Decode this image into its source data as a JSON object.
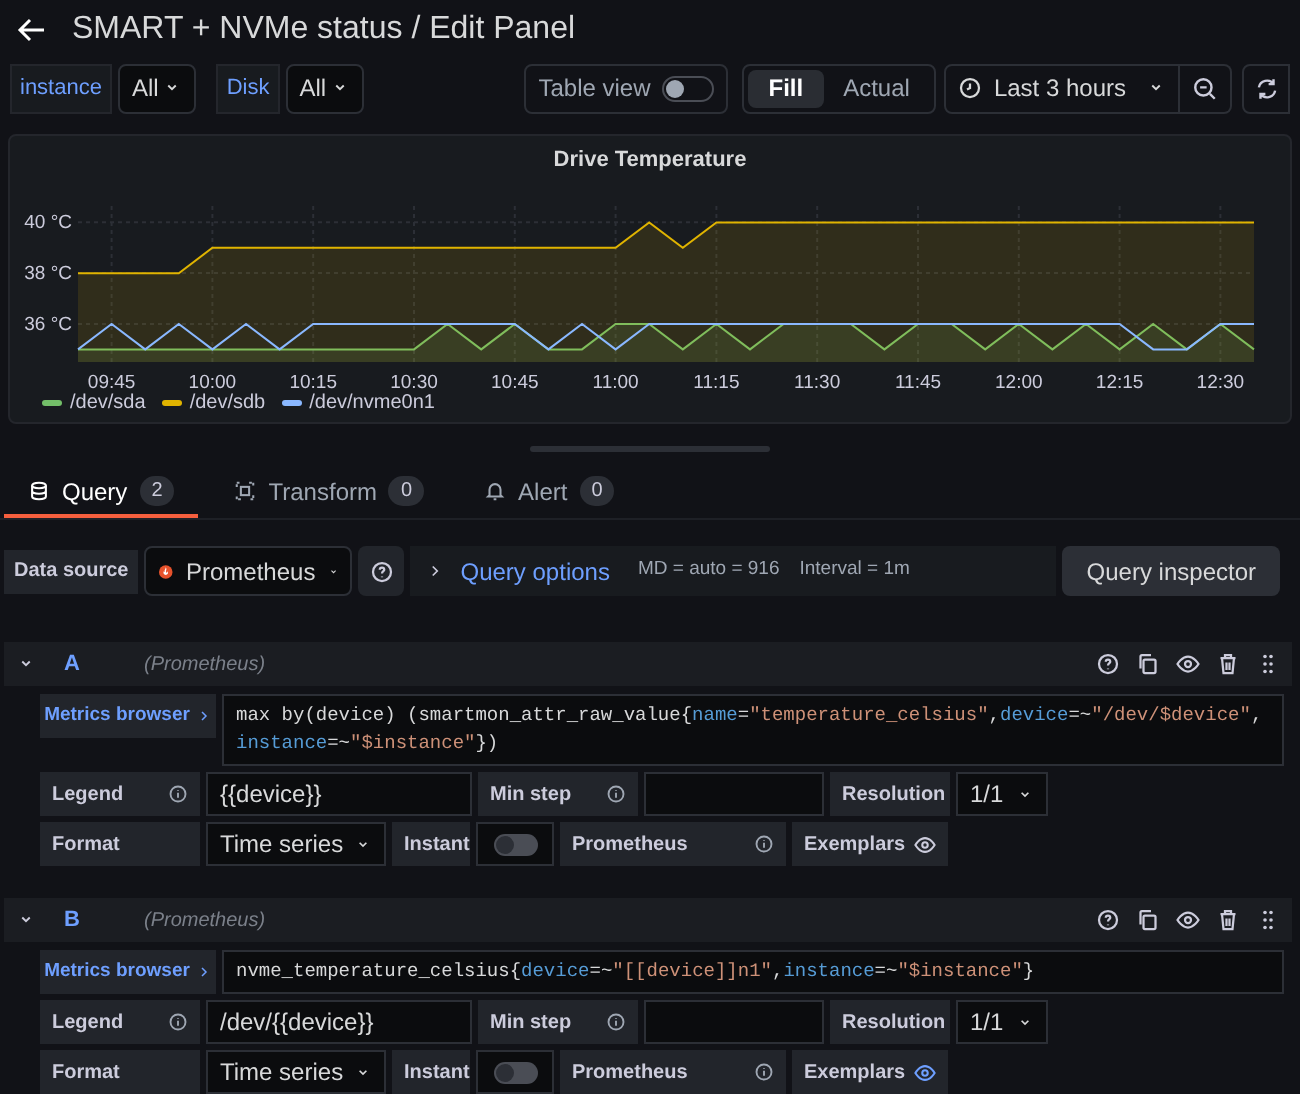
{
  "header": {
    "title": "SMART + NVMe status / Edit Panel"
  },
  "variables": [
    {
      "label": "instance",
      "value": "All"
    },
    {
      "label": "Disk",
      "value": "All"
    }
  ],
  "toolbar": {
    "table_view": {
      "label": "Table view",
      "on": false
    },
    "size_modes": [
      {
        "label": "Fill",
        "selected": true
      },
      {
        "label": "Actual",
        "selected": false
      }
    ],
    "time_range": "Last 3 hours"
  },
  "panel": {
    "chart_data": {
      "type": "area",
      "title": "Drive Temperature",
      "grid": true,
      "legend": "bottom",
      "x": [
        580,
        585,
        590,
        595,
        600,
        605,
        610,
        615,
        620,
        625,
        630,
        635,
        640,
        645,
        650,
        655,
        660,
        665,
        670,
        675,
        680,
        685,
        690,
        695,
        700,
        705,
        710,
        715,
        720,
        725,
        730,
        735,
        740,
        745,
        750,
        755
      ],
      "series": [
        {
          "name": "/dev/sda",
          "color": "#73bf69",
          "values": [
            35,
            35,
            35,
            35,
            35,
            35,
            35,
            35,
            35,
            35,
            35,
            36,
            35,
            36,
            35,
            35,
            36,
            36,
            35,
            36,
            35,
            36,
            36,
            36,
            35,
            36,
            36,
            35,
            36,
            35,
            36,
            35,
            36,
            35,
            36,
            35
          ]
        },
        {
          "name": "/dev/sdb",
          "color": "#e0b400",
          "values": [
            38,
            38,
            38,
            38,
            39,
            39,
            39,
            39,
            39,
            39,
            39,
            39,
            39,
            39,
            39,
            39,
            39,
            40,
            39,
            40,
            40,
            40,
            40,
            40,
            40,
            40,
            40,
            40,
            40,
            40,
            40,
            40,
            40,
            40,
            40,
            40
          ]
        },
        {
          "name": "/dev/nvme0n1",
          "type": "line",
          "color": "#8ab8ff",
          "values": [
            35,
            36,
            35,
            36,
            35,
            36,
            35,
            36,
            36,
            36,
            36,
            36,
            36,
            36,
            35,
            36,
            35,
            36,
            36,
            36,
            36,
            36,
            36,
            36,
            36,
            36,
            36,
            36,
            36,
            36,
            36,
            36,
            35,
            35,
            36,
            36
          ]
        }
      ],
      "ylim": [
        34.5,
        40.8
      ],
      "yticks": [
        {
          "value": 36,
          "label": "36 °C"
        },
        {
          "value": 38,
          "label": "38 °C"
        },
        {
          "value": 40,
          "label": "40 °C"
        }
      ],
      "xlim": [
        580,
        755
      ],
      "xticks": [
        {
          "value": 585,
          "label": "09:45"
        },
        {
          "value": 600,
          "label": "10:00"
        },
        {
          "value": 615,
          "label": "10:15"
        },
        {
          "value": 630,
          "label": "10:30"
        },
        {
          "value": 645,
          "label": "10:45"
        },
        {
          "value": 660,
          "label": "11:00"
        },
        {
          "value": 675,
          "label": "11:15"
        },
        {
          "value": 690,
          "label": "11:30"
        },
        {
          "value": 705,
          "label": "11:45"
        },
        {
          "value": 720,
          "label": "12:00"
        },
        {
          "value": 735,
          "label": "12:15"
        },
        {
          "value": 750,
          "label": "12:30"
        }
      ]
    }
  },
  "tabs": [
    {
      "label": "Query",
      "count": "2",
      "selected": true
    },
    {
      "label": "Transform",
      "count": "0",
      "selected": false
    },
    {
      "label": "Alert",
      "count": "0",
      "selected": false
    }
  ],
  "datasource": {
    "label": "Data source",
    "name": "Prometheus",
    "options_label": "Query options",
    "md": "MD = auto = 916",
    "interval": "Interval = 1m",
    "inspector": "Query inspector"
  },
  "queries": [
    {
      "ref": "A",
      "source": "(Prometheus)",
      "expanded": true,
      "browser": "Metrics browser",
      "query_lines": [
        "max by(device) (smartmon_attr_raw_value{name=\"temperature_celsius\",device=~\"/dev/$device\",",
        "instance=~\"$instance\"})"
      ],
      "legend_label": "Legend",
      "legend": "{{device}}",
      "minstep_label": "Min step",
      "resolution_label": "Resolution",
      "resolution": "1/1",
      "format_label": "Format",
      "format": "Time series",
      "instant_label": "Instant",
      "instant": false,
      "type_label": "Prometheus",
      "exemplars_label": "Exemplars",
      "exemplars": false
    },
    {
      "ref": "B",
      "source": "(Prometheus)",
      "expanded": true,
      "browser": "Metrics browser",
      "query_lines": [
        "nvme_temperature_celsius{device=~\"[[device]]n1\",instance=~\"$instance\"}"
      ],
      "legend_label": "Legend",
      "legend": "/dev/{{device}}",
      "minstep_label": "Min step",
      "resolution_label": "Resolution",
      "resolution": "1/1",
      "format_label": "Format",
      "format": "Time series",
      "instant_label": "Instant",
      "instant": false,
      "type_label": "Prometheus",
      "exemplars_label": "Exemplars",
      "exemplars": true
    }
  ]
}
